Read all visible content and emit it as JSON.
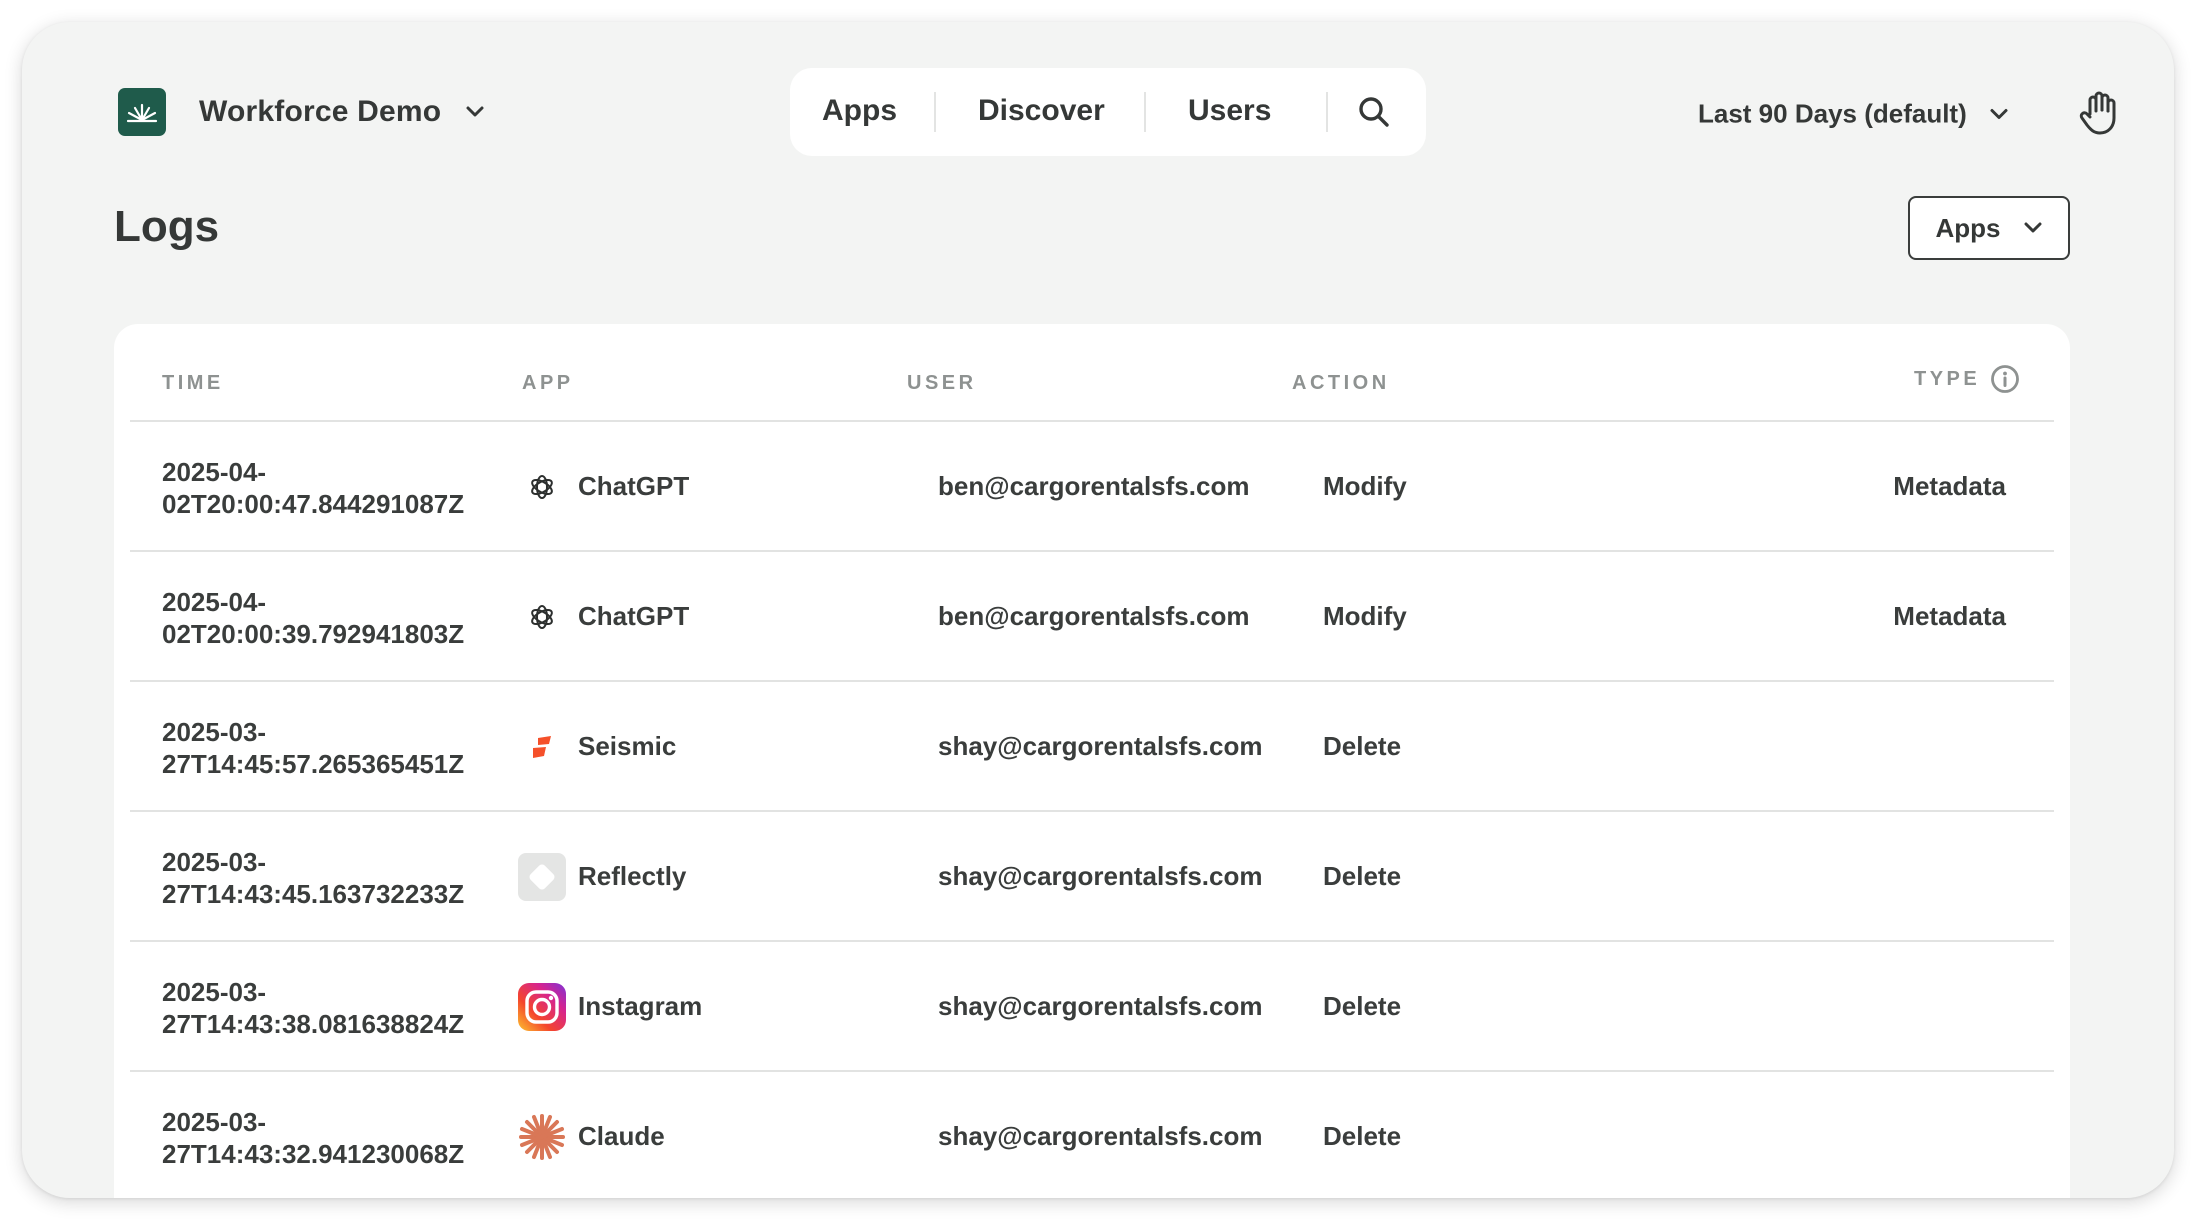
{
  "workspace": {
    "name": "Workforce Demo"
  },
  "nav": {
    "apps": "Apps",
    "discover": "Discover",
    "users": "Users"
  },
  "date_range": {
    "label": "Last 90 Days (default)"
  },
  "page": {
    "title": "Logs"
  },
  "filter": {
    "label": "Apps"
  },
  "table": {
    "headers": {
      "time": "TIME",
      "app": "APP",
      "user": "USER",
      "action": "ACTION",
      "type": "TYPE"
    },
    "rows": [
      {
        "time_line1": "2025-04-",
        "time_line2": "02T20:00:47.844291087Z",
        "app": "ChatGPT",
        "icon": "chatgpt-icon",
        "user": "ben@cargorentalsfs.com",
        "action": "Modify",
        "type": "Metadata"
      },
      {
        "time_line1": "2025-04-",
        "time_line2": "02T20:00:39.792941803Z",
        "app": "ChatGPT",
        "icon": "chatgpt-icon",
        "user": "ben@cargorentalsfs.com",
        "action": "Modify",
        "type": "Metadata"
      },
      {
        "time_line1": "2025-03-",
        "time_line2": "27T14:45:57.265365451Z",
        "app": "Seismic",
        "icon": "seismic-icon",
        "user": "shay@cargorentalsfs.com",
        "action": "Delete",
        "type": ""
      },
      {
        "time_line1": "2025-03-",
        "time_line2": "27T14:43:45.163732233Z",
        "app": "Reflectly",
        "icon": "reflectly-icon",
        "user": "shay@cargorentalsfs.com",
        "action": "Delete",
        "type": ""
      },
      {
        "time_line1": "2025-03-",
        "time_line2": "27T14:43:38.081638824Z",
        "app": "Instagram",
        "icon": "instagram-icon",
        "user": "shay@cargorentalsfs.com",
        "action": "Delete",
        "type": ""
      },
      {
        "time_line1": "2025-03-",
        "time_line2": "27T14:43:32.941230068Z",
        "app": "Claude",
        "icon": "claude-icon",
        "user": "shay@cargorentalsfs.com",
        "action": "Delete",
        "type": ""
      }
    ]
  },
  "colors": {
    "background": "#f3f4f3",
    "card": "#ffffff",
    "text": "#353837",
    "header_text": "#8e9291",
    "logo": "#1f5b4b"
  }
}
